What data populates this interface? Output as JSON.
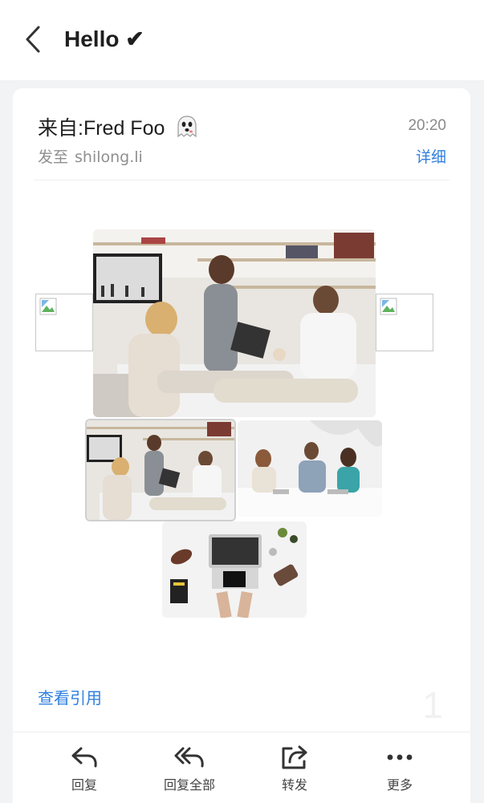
{
  "header": {
    "title": "Hello ✔"
  },
  "email": {
    "from_label": "来自:Fred Foo",
    "time": "20:20",
    "to_prefix": "发至",
    "to_value": "shilong.li",
    "details_label": "详细",
    "quote_label": "查看引用",
    "page_number": "1"
  },
  "actions": [
    {
      "label": "回复",
      "icon": "reply-icon"
    },
    {
      "label": "回复全部",
      "icon": "reply-all-icon"
    },
    {
      "label": "转发",
      "icon": "forward-icon"
    },
    {
      "label": "更多",
      "icon": "more-icon"
    }
  ],
  "colors": {
    "accent": "#2f7fe0",
    "background": "#f2f3f5"
  }
}
